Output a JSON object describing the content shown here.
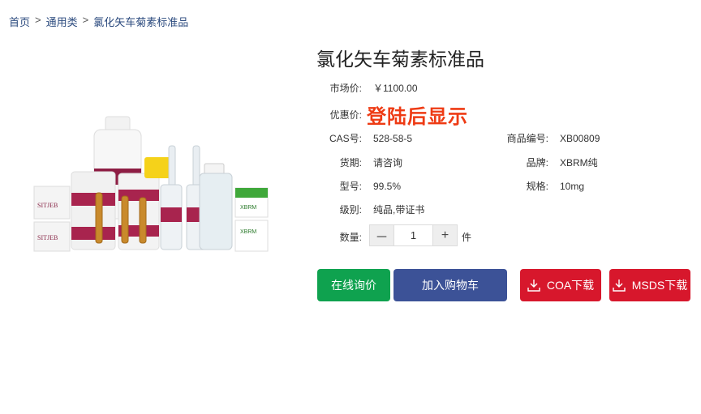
{
  "breadcrumb": {
    "home": "首页",
    "separator": ">",
    "category": "通用类",
    "current": "氯化矢车菊素标准品"
  },
  "product": {
    "title": "氯化矢车菊素标准品",
    "market_price_label": "市场价:",
    "market_price": "￥1100.00",
    "promo_price_label": "优惠价:",
    "promo_price_text": "登陆后显示",
    "cas_label": "CAS号:",
    "cas": "528-58-5",
    "sku_label": "商品编号:",
    "sku": "XB00809",
    "delivery_label": "货期:",
    "delivery": "请咨询",
    "brand_label": "品牌:",
    "brand": "XBRM纯",
    "model_label": "型号:",
    "model": "99.5%",
    "spec_label": "规格:",
    "spec": "10mg",
    "grade_label": "级别:",
    "grade": "纯品,带证书",
    "quantity_label": "数量:",
    "quantity": "1",
    "quantity_unit": "件",
    "minus": "－",
    "plus": "+"
  },
  "image": {
    "brand_text": "XBRM",
    "box_text": "SITJEB"
  },
  "actions": {
    "inquiry": "在线询价",
    "add_cart": "加入购物车",
    "coa": "COA下载",
    "msds": "MSDS下载"
  },
  "colors": {
    "inquiry": "#0fa24f",
    "add_cart": "#3c5297",
    "download": "#d7172c",
    "promo": "#ee3b14",
    "breadcrumb": "#2b4a7e"
  }
}
